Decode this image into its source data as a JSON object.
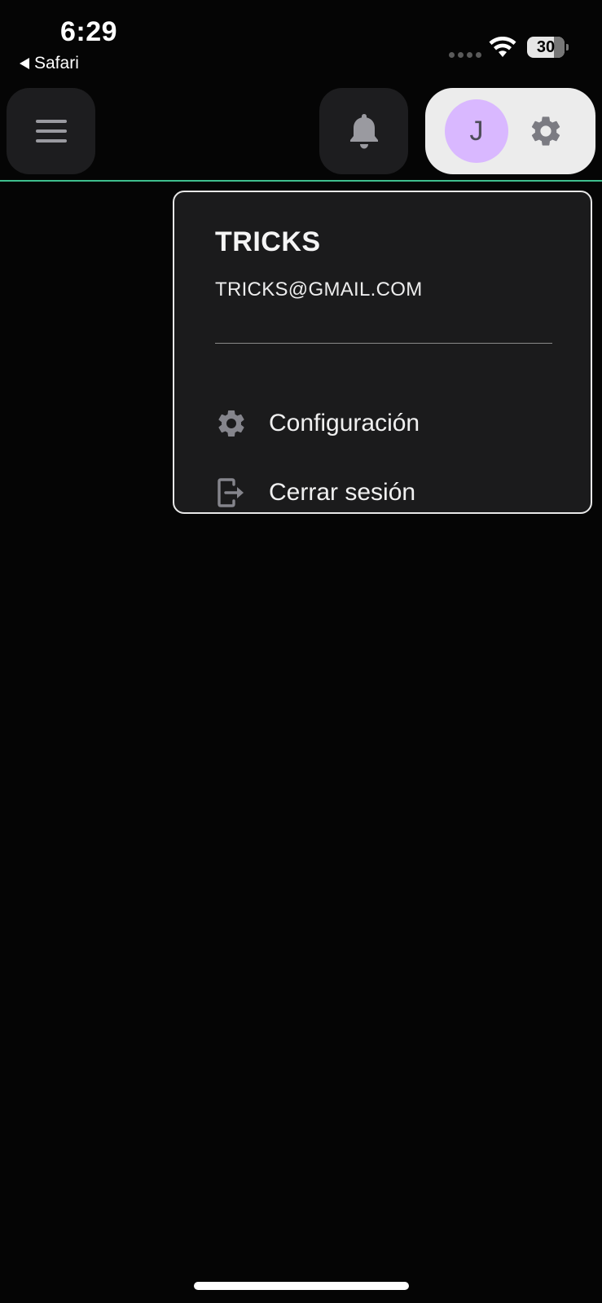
{
  "status_bar": {
    "time": "6:29",
    "back_app": "Safari",
    "battery_level": "30"
  },
  "header": {
    "menu_icon": "hamburger-icon",
    "notification_icon": "bell-icon",
    "avatar_initial": "J",
    "settings_icon": "gear-icon",
    "accent_line_color": "#3fbf8e",
    "avatar_color": "#d9b8ff"
  },
  "user_menu": {
    "name": "TRICKS",
    "email": "TRICKS@GMAIL.COM",
    "items": [
      {
        "label": "Configuración",
        "icon": "gear-icon"
      },
      {
        "label": "Cerrar sesión",
        "icon": "logout-icon"
      }
    ]
  }
}
